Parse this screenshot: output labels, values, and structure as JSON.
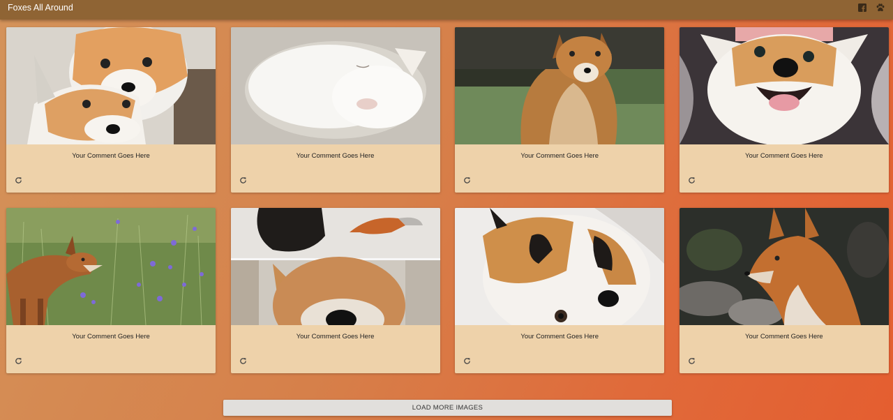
{
  "app": {
    "title": "Foxes All Around",
    "icons": [
      "facebook-icon",
      "paw-icon"
    ]
  },
  "cards": [
    {
      "comment": "Your Comment Goes Here",
      "image": "two-fox-kits"
    },
    {
      "comment": "Your Comment Goes Here",
      "image": "white-fox-sleeping"
    },
    {
      "comment": "Your Comment Goes Here",
      "image": "red-fox-sitting"
    },
    {
      "comment": "Your Comment Goes Here",
      "image": "fox-face-smiling"
    },
    {
      "comment": "Your Comment Goes Here",
      "image": "fox-in-flowers"
    },
    {
      "comment": "Your Comment Goes Here",
      "image": "fox-snow-collage"
    },
    {
      "comment": "Your Comment Goes Here",
      "image": "fox-upside-down"
    },
    {
      "comment": "Your Comment Goes Here",
      "image": "fox-profile-rocks"
    }
  ],
  "actions": {
    "load_more_label": "LOAD MORE IMAGES"
  },
  "colors": {
    "topbar": "#8f6434",
    "card": "#eed2aa",
    "button": "#e1dfdc"
  }
}
